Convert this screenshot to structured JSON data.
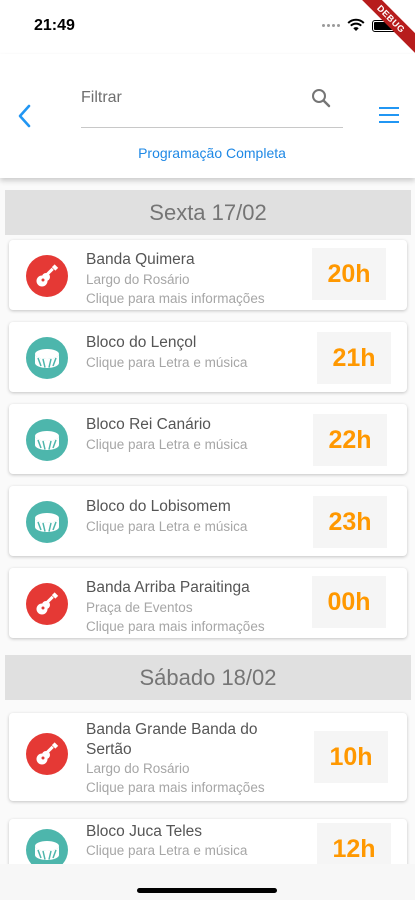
{
  "status_bar": {
    "time": "21:49"
  },
  "debug_banner": {
    "label": "DEBUG"
  },
  "header": {
    "filter_placeholder": "Filtrar",
    "full_schedule_link": "Programação Completa",
    "accent_color": "#2196f3"
  },
  "days": [
    {
      "title": "Sexta 17/02",
      "events": [
        {
          "icon": "guitar-icon",
          "title": "Banda Quimera",
          "location": "Largo do Rosário",
          "hint": "Clique para mais informações",
          "time": "20h"
        },
        {
          "icon": "drum-icon",
          "title": "Bloco do Lençol",
          "hint": "Clique para Letra e música",
          "time": "21h"
        },
        {
          "icon": "drum-icon",
          "title": "Bloco Rei Canário",
          "hint": "Clique para Letra e música",
          "time": "22h"
        },
        {
          "icon": "drum-icon",
          "title": "Bloco do Lobisomem",
          "hint": "Clique para Letra e música",
          "time": "23h"
        },
        {
          "icon": "guitar-icon",
          "title": "Banda Arriba Paraitinga",
          "location": "Praça de Eventos",
          "hint": "Clique para mais informações",
          "time": "00h"
        }
      ]
    },
    {
      "title": "Sábado 18/02",
      "events": [
        {
          "icon": "guitar-icon",
          "title": "Banda Grande Banda do",
          "title_line2": "Sertão",
          "location": "Largo do Rosário",
          "hint": "Clique para mais informações",
          "time": "10h"
        },
        {
          "icon": "drum-icon",
          "title": "Bloco Juca Teles",
          "hint": "Clique para Letra e música",
          "time": "12h"
        }
      ]
    }
  ],
  "colors": {
    "band_icon": "#e53935",
    "bloco_icon": "#4db6ac",
    "time_text": "#ff9800"
  }
}
